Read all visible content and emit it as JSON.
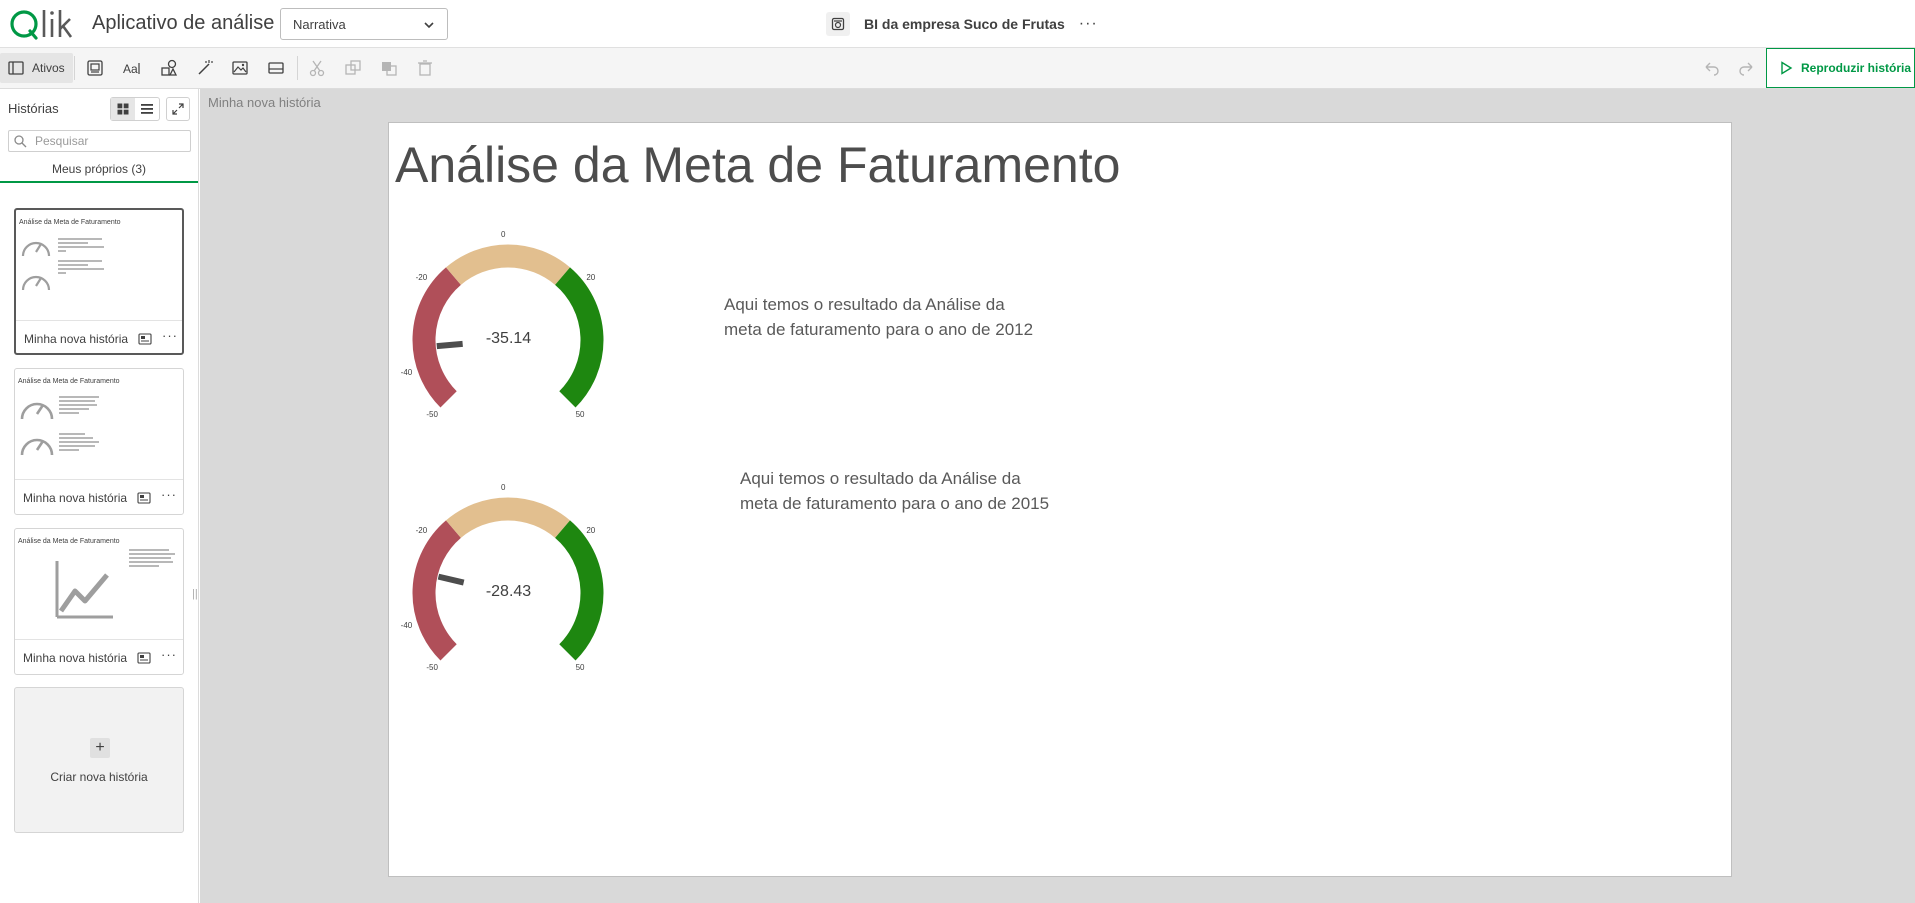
{
  "header": {
    "app_title": "Aplicativo de análise",
    "mode_selected": "Narrativa",
    "sheet_name": "BI da empresa Suco de Frutas",
    "more_label": "···"
  },
  "toolbar": {
    "assets_label": "Ativos",
    "play_label": "Reproduzir história"
  },
  "sidebar": {
    "title": "Histórias",
    "search_placeholder": "Pesquisar",
    "tab_label": "Meus próprios (3)",
    "cards": [
      {
        "thumb_title": "Análise da Meta de Faturamento",
        "label": "Minha nova história",
        "more": "···"
      },
      {
        "thumb_title": "Análise da Meta de Faturamento",
        "label": "Minha nova história",
        "more": "···"
      },
      {
        "thumb_title": "Análise da Meta de Faturamento",
        "label": "Minha nova história",
        "more": "···"
      }
    ],
    "create_label": "Criar nova história",
    "create_plus": "+"
  },
  "canvas": {
    "breadcrumb": "Minha nova história",
    "slide_title": "Análise da Meta de Faturamento",
    "gauges": [
      {
        "value": -35.14,
        "value_label": "-35.14",
        "min": -50,
        "max": 50,
        "ticks": [
          "-50",
          "-40",
          "-20",
          "0",
          "20",
          "50"
        ],
        "bands": [
          {
            "from": -50,
            "to": -15,
            "color": "#b04f59"
          },
          {
            "from": -15,
            "to": 15,
            "color": "#e2bf8f"
          },
          {
            "from": 15,
            "to": 50,
            "color": "#1e8710"
          }
        ],
        "text": "Aqui temos o resultado da Análise da meta de faturamento para o ano de 2012"
      },
      {
        "value": -28.43,
        "value_label": "-28.43",
        "min": -50,
        "max": 50,
        "ticks": [
          "-50",
          "-40",
          "-20",
          "0",
          "20",
          "50"
        ],
        "bands": [
          {
            "from": -50,
            "to": -15,
            "color": "#b04f59"
          },
          {
            "from": -15,
            "to": 15,
            "color": "#e2bf8f"
          },
          {
            "from": 15,
            "to": 50,
            "color": "#1e8710"
          }
        ],
        "text": "Aqui temos o resultado da Análise da meta de faturamento para o ano de 2015"
      }
    ]
  },
  "colors": {
    "accent": "#009845",
    "needle": "#4d4d4d"
  }
}
